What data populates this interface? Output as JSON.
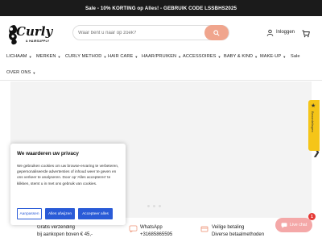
{
  "announcement": "Sale - 10% KORTING op Alles! - GEBRUIK CODE LSSBHS2025",
  "logo": {
    "brand": "Curly",
    "tagline": "& HAIRSUPPLY"
  },
  "search": {
    "placeholder": "Waar bent u naar op zoek?"
  },
  "account": {
    "login_label": "Inloggen"
  },
  "nav": {
    "items": [
      {
        "label": "LICHAAM"
      },
      {
        "label": "MERKEN"
      },
      {
        "label": "CURLY METHOD"
      },
      {
        "label": "HAIR CARE"
      },
      {
        "label": "HAAR/PRUIKEN"
      },
      {
        "label": "ACCESSOIRES"
      },
      {
        "label": "BABY & KIND"
      },
      {
        "label": "MAKE-UP"
      },
      {
        "label": "Sale"
      },
      {
        "label": "OVER ONS"
      }
    ]
  },
  "side_tab": {
    "label": "Beoordelingen"
  },
  "cookie": {
    "title": "We waarderen uw privacy",
    "body": "We gebruiken cookies om uw browse-ervaring te verbeteren, gepersonaliseerde advertenties of inhoud weer te geven en ons verkeer te analyseren. Door op 'Alles accepteren' te klikken, stemt u in met ons gebruik van cookies.",
    "customize_label": "Aanpassen",
    "reject_label": "Alles afwijzen",
    "accept_label": "Accepteer alles"
  },
  "features": {
    "shipping_title": "Gratis verzending",
    "shipping_sub": "bij aankopen boven € 45,-",
    "whatsapp_title": "WhatsApp",
    "whatsapp_sub": "+31685865595",
    "payment_title": "Veilige betaling",
    "payment_sub": "Diverse betaalmethoden"
  },
  "chat": {
    "label": "Live chat",
    "badge": "1"
  },
  "colors": {
    "accent": "#f0a58d",
    "cookie_button": "#2a5bd7",
    "chat": "#f4a8a8",
    "side_tab": "#f5c518",
    "announcement_bg": "#1b1b1b"
  }
}
